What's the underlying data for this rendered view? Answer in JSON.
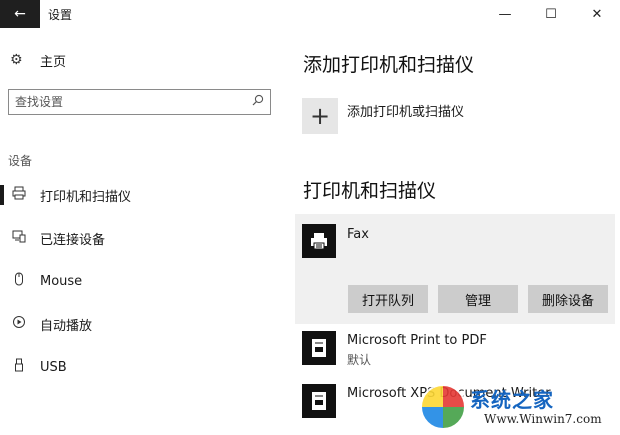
{
  "window": {
    "back_glyph": "←",
    "title": "设置",
    "minimize_glyph": "—",
    "maximize_glyph": "☐",
    "close_glyph": "✕"
  },
  "sidebar": {
    "home_label": "主页",
    "search_placeholder": "查找设置",
    "section_label": "设备",
    "items": [
      {
        "label": "打印机和扫描仪",
        "icon": "printer-icon",
        "selected": true
      },
      {
        "label": "已连接设备",
        "icon": "connected-devices-icon",
        "selected": false
      },
      {
        "label": "Mouse",
        "icon": "mouse-icon",
        "selected": false
      },
      {
        "label": "自动播放",
        "icon": "autoplay-icon",
        "selected": false
      },
      {
        "label": "USB",
        "icon": "usb-icon",
        "selected": false
      }
    ]
  },
  "main": {
    "add_heading": "添加打印机和扫描仪",
    "add_button_label": "添加打印机或扫描仪",
    "list_heading": "打印机和扫描仪",
    "printers": [
      {
        "name": "Fax",
        "status": "",
        "expanded": true
      },
      {
        "name": "Microsoft Print to PDF",
        "status": "默认",
        "expanded": false
      },
      {
        "name": "Microsoft XPS Document Writer",
        "status": "",
        "expanded": false
      }
    ],
    "actions": {
      "open_queue": "打开队列",
      "manage": "管理",
      "remove_device": "删除设备"
    }
  },
  "watermark": {
    "brand": "系统之家",
    "url": "Www.Winwin7.com"
  },
  "colors": {
    "back_button_bg": "#1f1f1f",
    "selected_row_bg": "#f0f0f0",
    "action_button_bg": "#cccccc",
    "printer_tile_bg": "#111111"
  }
}
